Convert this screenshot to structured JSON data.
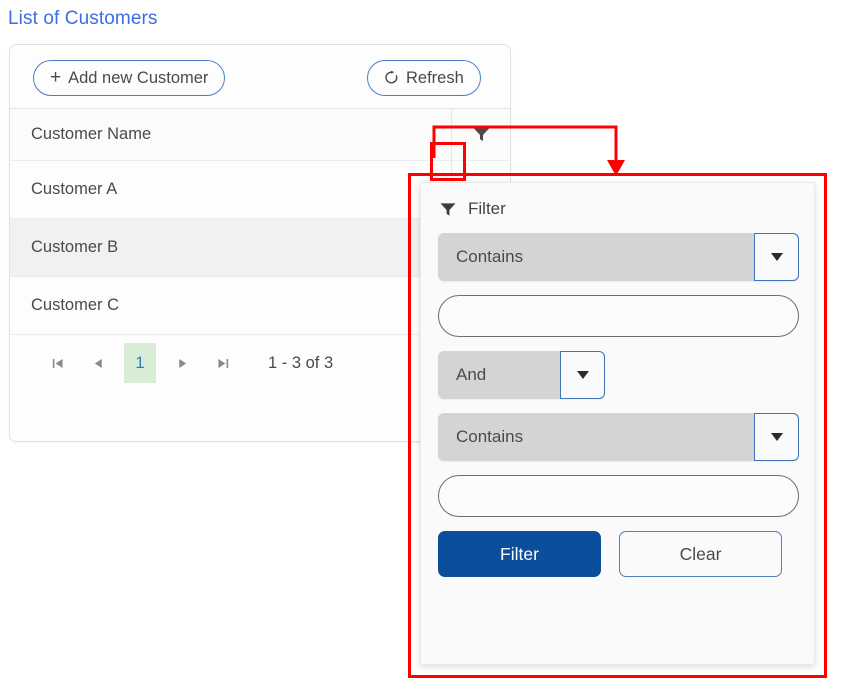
{
  "page": {
    "title": "List of Customers"
  },
  "toolbar": {
    "add_label": "Add new Customer",
    "add_icon": "plus-icon",
    "refresh_label": "Refresh",
    "refresh_icon": "refresh-icon"
  },
  "table": {
    "columns": [
      "Customer Name"
    ],
    "header_filter_icon": "funnel-icon",
    "rows": [
      {
        "name": "Customer A"
      },
      {
        "name": "Customer B"
      },
      {
        "name": "Customer C"
      }
    ]
  },
  "pagination": {
    "first_icon": "first-page-icon",
    "prev_icon": "previous-page-icon",
    "current_page": "1",
    "next_icon": "next-page-icon",
    "last_icon": "last-page-icon",
    "range_text": "1 - 3 of 3"
  },
  "filter_panel": {
    "header_label": "Filter",
    "header_icon": "funnel-icon",
    "operator1": "Contains",
    "value1": "",
    "logic": "And",
    "operator2": "Contains",
    "value2": "",
    "apply_label": "Filter",
    "clear_label": "Clear"
  },
  "colors": {
    "title": "#3a6fe0",
    "accent_blue": "#4f7dc0",
    "primary_button": "#0b4e9b",
    "page_highlight": "#d9ecd5",
    "annotation_red": "#ff0000",
    "dropdown_gray": "#d4d4d4"
  }
}
